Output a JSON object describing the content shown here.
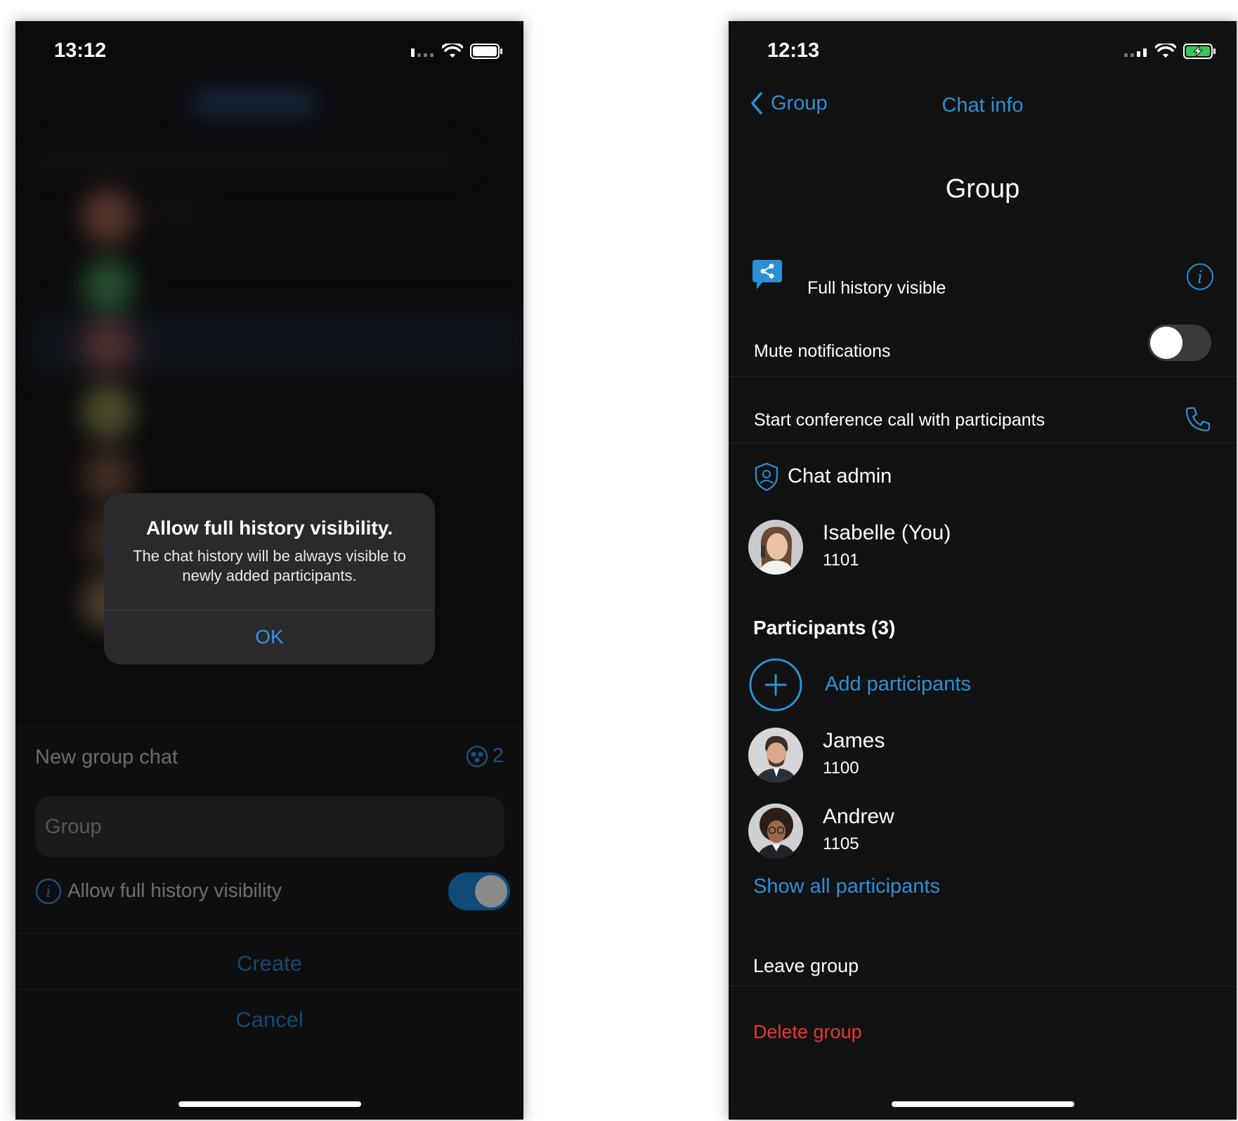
{
  "left_screen": {
    "status_time": "13:12",
    "alert": {
      "title": "Allow full history visibility.",
      "message": "The chat history will be always visible to newly added participants.",
      "ok_label": "OK"
    },
    "sheet": {
      "title": "New group chat",
      "participant_count": "2",
      "name_placeholder": "Group",
      "history_label": "Allow full history visibility",
      "history_enabled": true,
      "create_label": "Create",
      "cancel_label": "Cancel"
    }
  },
  "right_screen": {
    "status_time": "12:13",
    "nav": {
      "back_label": "Group",
      "title": "Chat info"
    },
    "group_name": "Group",
    "history_row": {
      "label": "Full history visible"
    },
    "mute_row": {
      "label": "Mute notifications",
      "enabled": false
    },
    "conference_row": {
      "label": "Start conference call with participants"
    },
    "admin_section": {
      "title": "Chat admin"
    },
    "admin": {
      "name": "Isabelle (You)",
      "extension": "1101"
    },
    "participants_section": {
      "title": "Participants (3)"
    },
    "add_participants_label": "Add participants",
    "participants": [
      {
        "name": "James",
        "extension": "1100"
      },
      {
        "name": "Andrew",
        "extension": "1105"
      }
    ],
    "show_all_label": "Show all participants",
    "leave_label": "Leave group",
    "delete_label": "Delete group"
  },
  "colors": {
    "accent": "#2b8fd6",
    "danger": "#e53935",
    "dialog_ok": "#3a8ee8",
    "battery_charging": "#34c759"
  }
}
